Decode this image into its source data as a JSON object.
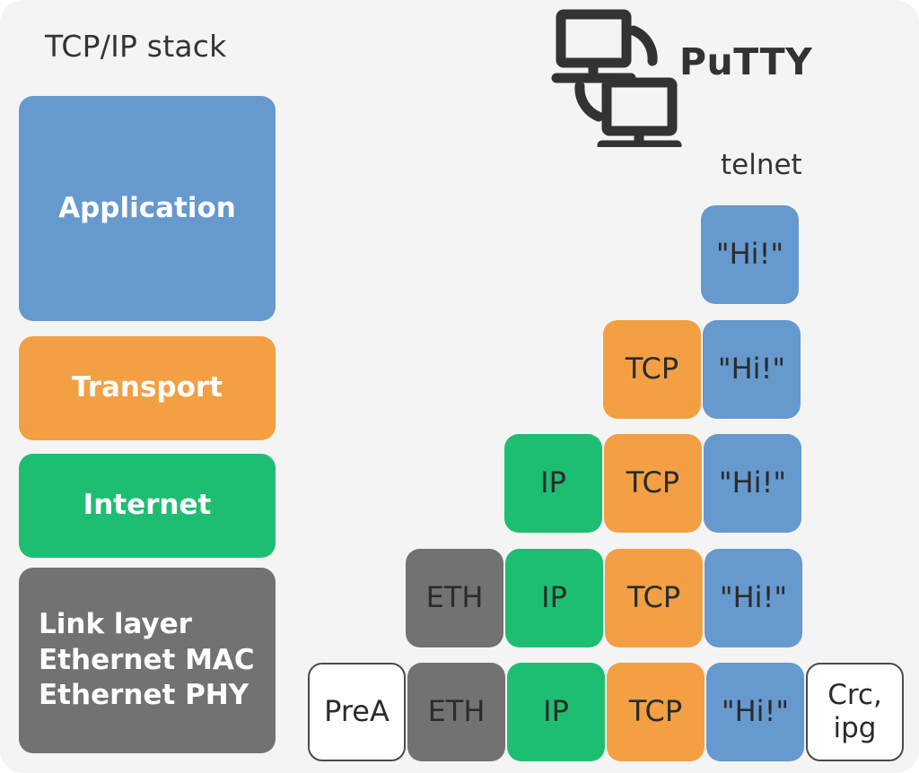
{
  "diagram": {
    "title": "TCP/IP stack",
    "background_color": "#f4f4f4"
  },
  "colors": {
    "application_blue": "#6699ce",
    "transport_orange": "#f2a043",
    "internet_green": "#1ebe72",
    "link_gray": "#727272",
    "text_dark": "#333333",
    "box_white": "#ffffff"
  },
  "stack": {
    "title": "TCP/IP stack",
    "layers": [
      {
        "label": "Application",
        "color": "#6699ce",
        "align": "center"
      },
      {
        "label": "Transport",
        "color": "#f2a043",
        "align": "center"
      },
      {
        "label": "Internet",
        "color": "#1ebe72",
        "align": "center"
      },
      {
        "label": "Link layer\nEthernet MAC\nEthernet PHY",
        "color": "#727272",
        "align": "left"
      }
    ]
  },
  "app": {
    "logo_icon": "two-monitors-network-icon",
    "wordmark": "PuTTY",
    "protocol_label": "telnet"
  },
  "packets": {
    "rows": [
      {
        "layer": "Application",
        "cells": [
          {
            "label": "\"Hi!\"",
            "color": "#6699ce",
            "style": "blue"
          }
        ]
      },
      {
        "layer": "Transport",
        "cells": [
          {
            "label": "TCP",
            "color": "#f2a043",
            "style": "orange"
          },
          {
            "label": "\"Hi!\"",
            "color": "#6699ce",
            "style": "blue"
          }
        ]
      },
      {
        "layer": "Internet",
        "cells": [
          {
            "label": "IP",
            "color": "#1ebe72",
            "style": "green"
          },
          {
            "label": "TCP",
            "color": "#f2a043",
            "style": "orange"
          },
          {
            "label": "\"Hi!\"",
            "color": "#6699ce",
            "style": "blue"
          }
        ]
      },
      {
        "layer": "Ethernet MAC",
        "cells": [
          {
            "label": "ETH",
            "color": "#727272",
            "style": "gray"
          },
          {
            "label": "IP",
            "color": "#1ebe72",
            "style": "green"
          },
          {
            "label": "TCP",
            "color": "#f2a043",
            "style": "orange"
          },
          {
            "label": "\"Hi!\"",
            "color": "#6699ce",
            "style": "blue"
          }
        ]
      },
      {
        "layer": "Ethernet PHY",
        "cells": [
          {
            "label": "PreA",
            "color": "#ffffff",
            "style": "white"
          },
          {
            "label": "ETH",
            "color": "#727272",
            "style": "gray"
          },
          {
            "label": "IP",
            "color": "#1ebe72",
            "style": "green"
          },
          {
            "label": "TCP",
            "color": "#f2a043",
            "style": "orange"
          },
          {
            "label": "\"Hi!\"",
            "color": "#6699ce",
            "style": "blue"
          },
          {
            "label": "Crc,\nipg",
            "color": "#ffffff",
            "style": "white"
          }
        ]
      }
    ]
  }
}
